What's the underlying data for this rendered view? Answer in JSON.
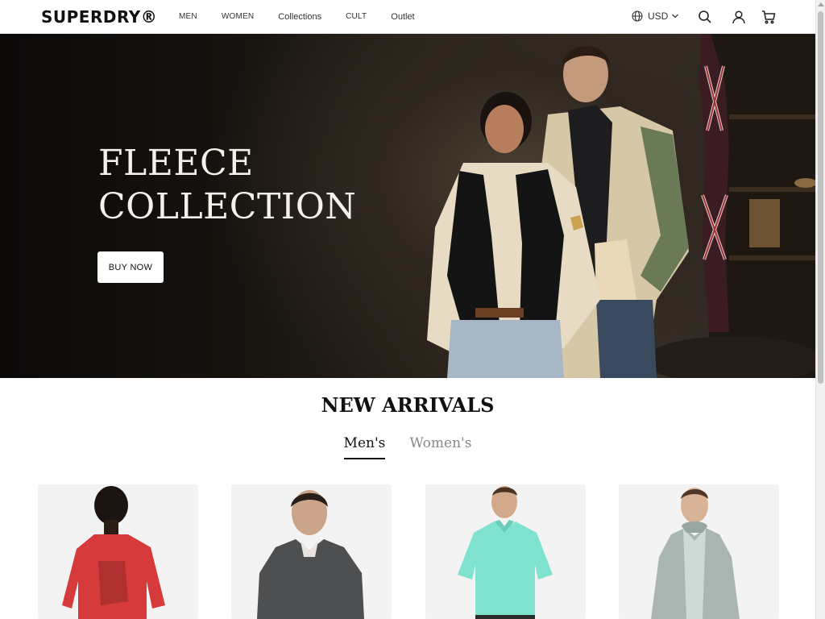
{
  "header": {
    "logo": "SUPERDRY®",
    "nav": [
      {
        "label": "MEN"
      },
      {
        "label": "WOMEN"
      },
      {
        "label": "Collections"
      },
      {
        "label": "CULT"
      },
      {
        "label": "Outlet"
      }
    ],
    "currency": {
      "label": "USD",
      "icon": "globe-icon"
    },
    "icons": [
      "search-icon",
      "user-icon",
      "cart-icon"
    ]
  },
  "hero": {
    "title_line1": "FLEECE",
    "title_line2": "COLLECTION",
    "cta_label": "BUY NOW"
  },
  "new_arrivals": {
    "title": "NEW ARRIVALS",
    "tabs": [
      {
        "label": "Men's",
        "active": true
      },
      {
        "label": "Women's",
        "active": false
      }
    ],
    "products": [
      {
        "color": "#d63a3a",
        "garment": "t-shirt"
      },
      {
        "color": "#4d4f50",
        "garment": "knit-sweater"
      },
      {
        "color": "#7fe3d0",
        "garment": "polo-shirt"
      },
      {
        "color": "#a9b6b2",
        "garment": "hoodie"
      }
    ]
  },
  "colors": {
    "hero_bg": "#1a1612",
    "hero_text": "#f4f0ea",
    "accent_text": "#111111",
    "inactive_tab": "#8a8a8a"
  }
}
